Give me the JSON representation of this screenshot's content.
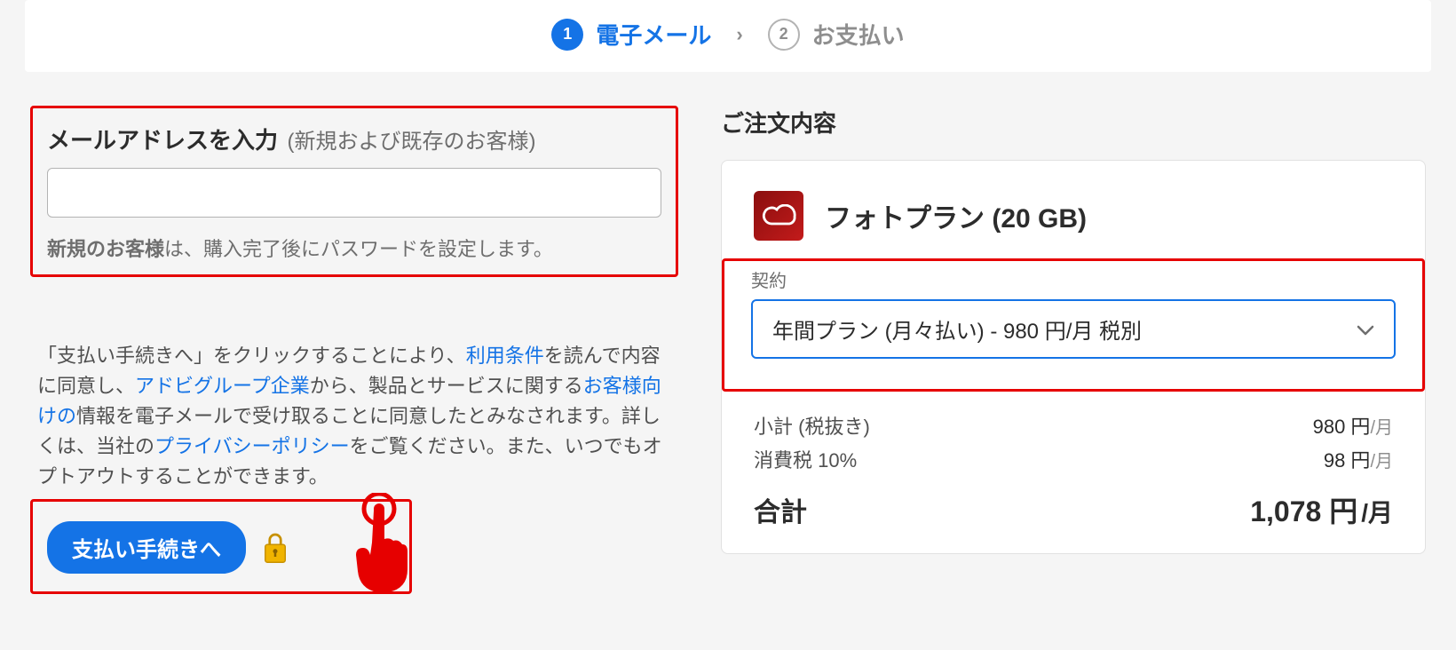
{
  "steps": {
    "step1": {
      "num": "1",
      "label": "電子メール"
    },
    "sep": "›",
    "step2": {
      "num": "2",
      "label": "お支払い"
    }
  },
  "email": {
    "heading": "メールアドレスを入力",
    "sub": "(新規および既存のお客様)",
    "value": "",
    "note_bold": "新規のお客様",
    "note_rest": "は、購入完了後にパスワードを設定します。"
  },
  "consent": {
    "t1": "「支払い手続きへ」をクリックすることにより、",
    "link1": "利用条件",
    "t2": "を読んで内容に同意し、",
    "link2": "アドビグループ企業",
    "t3": "から、製品とサービスに関する",
    "link3": "お客様向けの",
    "t4": "情報を電子メールで受け取ることに同意したとみなされます。詳しくは、当社の",
    "link4": "プライバシーポリシー",
    "t5": "をご覧ください。また、いつでもオプトアウトすることができます。"
  },
  "proceed": {
    "label": "支払い手続きへ"
  },
  "order": {
    "title": "ご注文内容",
    "product": "フォトプラン (20 GB)",
    "plan_label": "契約",
    "plan_selected": "年間プラン (月々払い)  -  980 円/月  税別",
    "rows": {
      "subtotal_label": "小計 (税抜き)",
      "subtotal_val": "980 円",
      "subtotal_unit": "/月",
      "tax_label": "消費税 10%",
      "tax_val": "98 円",
      "tax_unit": "/月"
    },
    "total_label": "合計",
    "total_val": "1,078 円",
    "total_unit": "/月"
  }
}
